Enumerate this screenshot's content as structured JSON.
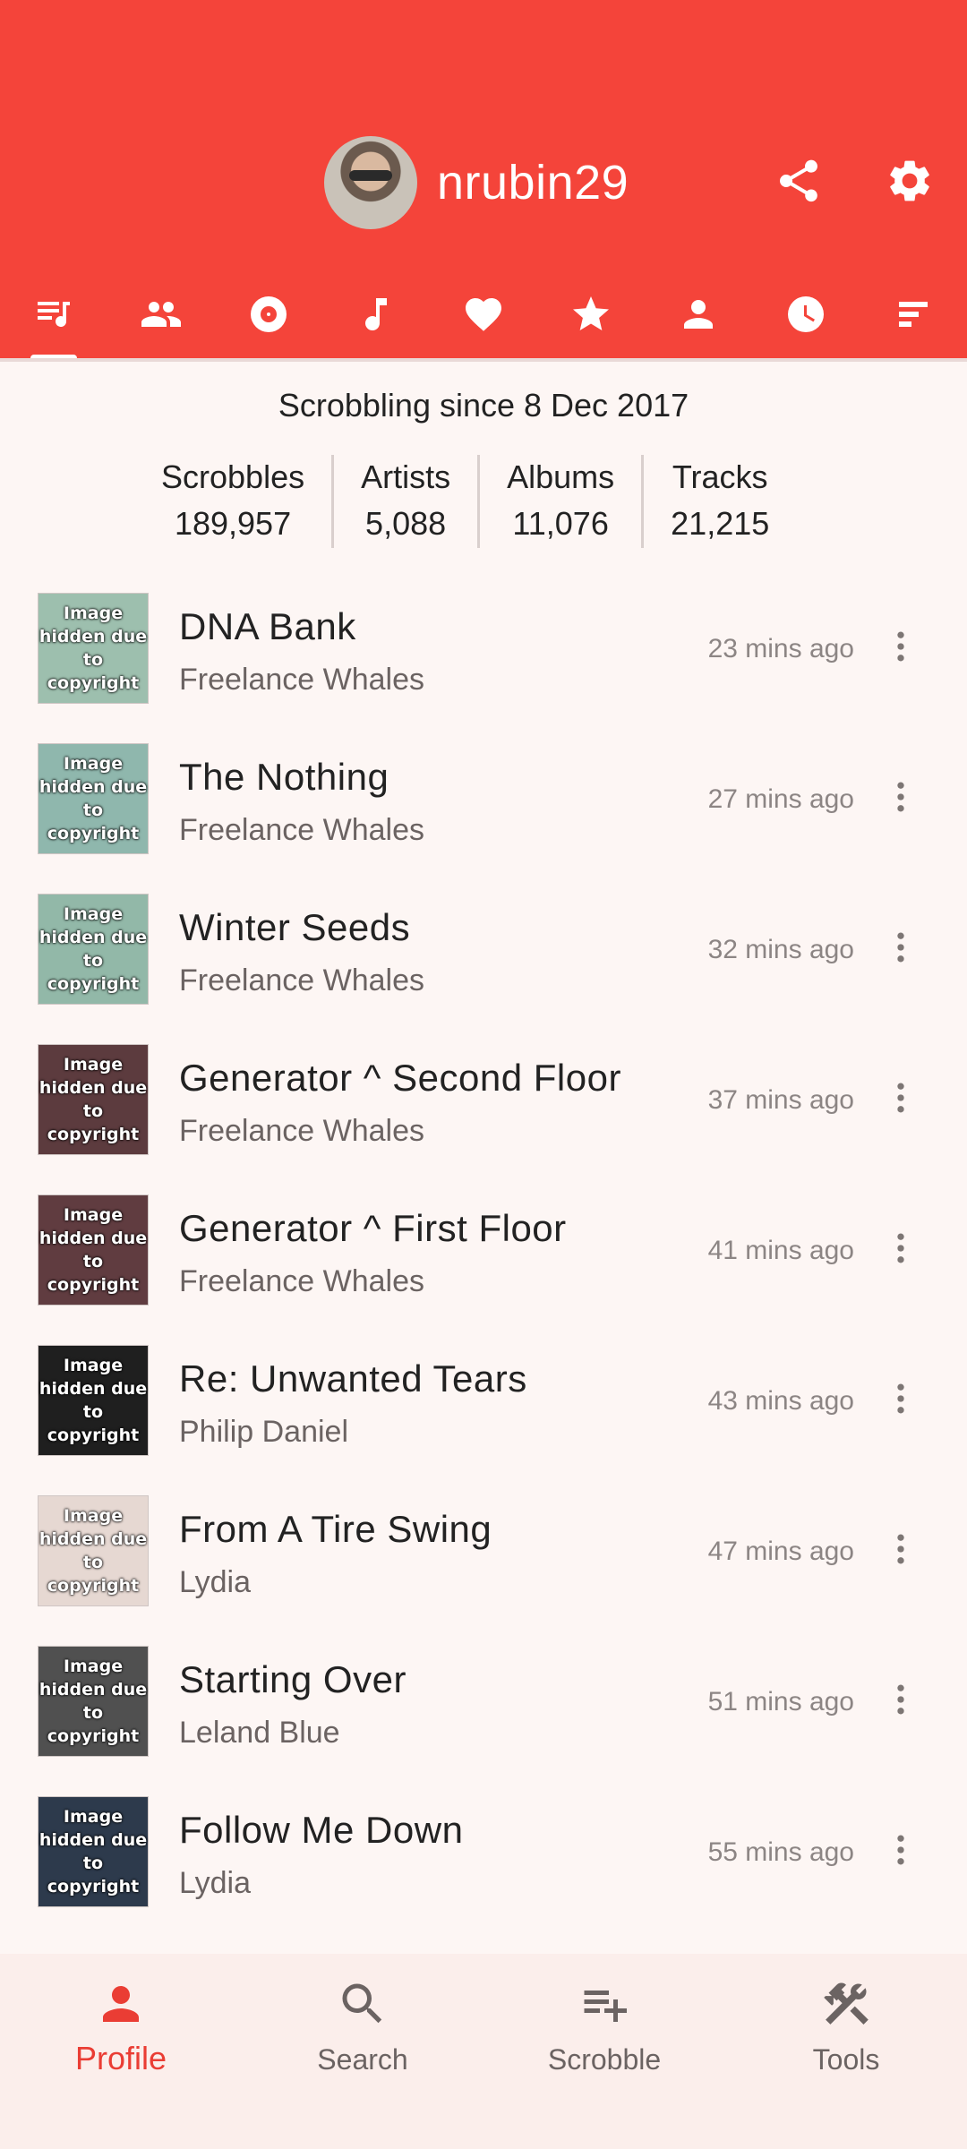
{
  "app": {
    "accent": "#f4443a",
    "background": "#fdf6f4"
  },
  "header": {
    "username": "nrubin29",
    "avatar": "user-avatar",
    "actions": [
      {
        "icon": "share-icon"
      },
      {
        "icon": "settings-gear-icon"
      }
    ]
  },
  "tabs": [
    {
      "icon": "queue-music-icon",
      "selected": true
    },
    {
      "icon": "people-icon"
    },
    {
      "icon": "album-disc-icon"
    },
    {
      "icon": "music-note-icon"
    },
    {
      "icon": "heart-icon"
    },
    {
      "icon": "star-icon"
    },
    {
      "icon": "person-icon"
    },
    {
      "icon": "clock-icon"
    },
    {
      "icon": "bar-chart-icon"
    }
  ],
  "summary": {
    "since": "Scrobbling since 8 Dec 2017",
    "stats": [
      {
        "label": "Scrobbles",
        "value": "189,957"
      },
      {
        "label": "Artists",
        "value": "5,088"
      },
      {
        "label": "Albums",
        "value": "11,076"
      },
      {
        "label": "Tracks",
        "value": "21,215"
      }
    ]
  },
  "tracks": [
    {
      "title": "DNA Bank",
      "artist": "Freelance Whales",
      "time": "23 mins ago",
      "art_label": "Image hidden due to copyright",
      "art_color": "#9dbfae"
    },
    {
      "title": "The Nothing",
      "artist": "Freelance Whales",
      "time": "27 mins ago",
      "art_label": "Image hidden due to copyright",
      "art_color": "#8fb7ad"
    },
    {
      "title": "Winter Seeds",
      "artist": "Freelance Whales",
      "time": "32 mins ago",
      "art_label": "Image hidden due to copyright",
      "art_color": "#92b8a8"
    },
    {
      "title": "Generator ^ Second Floor",
      "artist": "Freelance Whales",
      "time": "37 mins ago",
      "art_label": "Image hidden due to copyright",
      "art_color": "#5c3b3e"
    },
    {
      "title": "Generator ^ First Floor",
      "artist": "Freelance Whales",
      "time": "41 mins ago",
      "art_label": "Image hidden due to copyright",
      "art_color": "#603c40"
    },
    {
      "title": "Re: Unwanted Tears",
      "artist": "Philip Daniel",
      "time": "43 mins ago",
      "art_label": "Image hidden due to copyright",
      "art_color": "#1f1f1f"
    },
    {
      "title": "From A Tire Swing",
      "artist": "Lydia",
      "time": "47 mins ago",
      "art_label": "Image hidden due to copyright",
      "art_color": "#e6d8d2"
    },
    {
      "title": "Starting Over",
      "artist": "Leland Blue",
      "time": "51 mins ago",
      "art_label": "Image hidden due to copyright",
      "art_color": "#505050"
    },
    {
      "title": "Follow Me Down",
      "artist": "Lydia",
      "time": "55 mins ago",
      "art_label": "Image hidden due to copyright",
      "art_color": "#2d3a4c"
    }
  ],
  "bottom_nav": [
    {
      "label": "Profile",
      "icon": "person-icon",
      "selected": true
    },
    {
      "label": "Search",
      "icon": "search-icon"
    },
    {
      "label": "Scrobble",
      "icon": "playlist-add-icon"
    },
    {
      "label": "Tools",
      "icon": "tools-icon"
    }
  ]
}
